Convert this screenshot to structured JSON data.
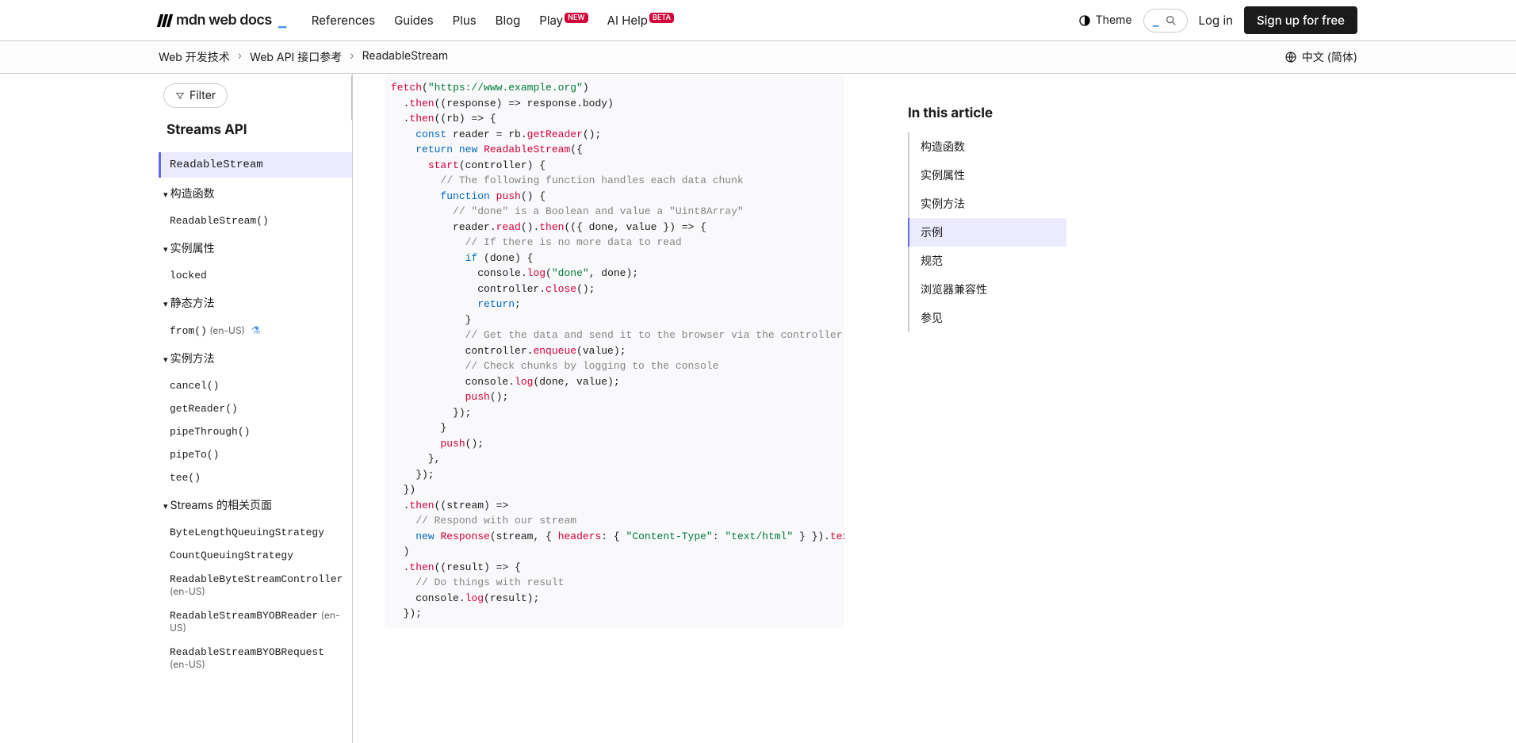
{
  "nav": {
    "logo": "mdn web docs",
    "links": [
      "References",
      "Guides",
      "Plus",
      "Blog",
      "Play",
      "AI Help"
    ],
    "badges": {
      "4": "NEW",
      "5": "BETA"
    },
    "theme": "Theme",
    "login": "Log in",
    "signup": "Sign up for free"
  },
  "breadcrumbs": {
    "items": [
      "Web 开发技术",
      "Web API 接口参考",
      "ReadableStream"
    ],
    "language": "中文 (简体)"
  },
  "sidebar": {
    "filter": "Filter",
    "title": "Streams API",
    "active": "ReadableStream",
    "sections": [
      {
        "header": "构造函数",
        "items": [
          {
            "label": "ReadableStream()"
          }
        ]
      },
      {
        "header": "实例属性",
        "items": [
          {
            "label": "locked"
          }
        ]
      },
      {
        "header": "静态方法",
        "items": [
          {
            "label": "from()",
            "suffix": "(en-US)",
            "flask": true
          }
        ]
      },
      {
        "header": "实例方法",
        "items": [
          {
            "label": "cancel()"
          },
          {
            "label": "getReader()"
          },
          {
            "label": "pipeThrough()"
          },
          {
            "label": "pipeTo()"
          },
          {
            "label": "tee()"
          }
        ]
      },
      {
        "header": "Streams 的相关页面",
        "items": [
          {
            "label": "ByteLengthQueuingStrategy"
          },
          {
            "label": "CountQueuingStrategy"
          },
          {
            "label": "ReadableByteStreamController",
            "suffix": "(en-US)"
          },
          {
            "label": "ReadableStreamBYOBReader",
            "suffix": "(en-US)"
          },
          {
            "label": "ReadableStreamBYOBRequest",
            "suffix": "(en-US)"
          }
        ]
      }
    ]
  },
  "toc": {
    "title": "In this article",
    "items": [
      "构造函数",
      "实例属性",
      "实例方法",
      "示例",
      "规范",
      "浏览器兼容性",
      "参见"
    ],
    "active": 3
  },
  "code": {
    "lines": [
      [
        {
          "t": "fetch",
          "c": "tok-fn"
        },
        {
          "t": "("
        },
        {
          "t": "\"https://www.example.org\"",
          "c": "tok-str"
        },
        {
          "t": ")"
        }
      ],
      [
        {
          "t": "  ."
        },
        {
          "t": "then",
          "c": "tok-prop"
        },
        {
          "t": "(("
        },
        {
          "t": "response",
          "c": "tok-param"
        },
        {
          "t": ") => response.body)"
        }
      ],
      [
        {
          "t": "  ."
        },
        {
          "t": "then",
          "c": "tok-prop"
        },
        {
          "t": "(("
        },
        {
          "t": "rb",
          "c": "tok-param"
        },
        {
          "t": ") => {"
        }
      ],
      [
        {
          "t": "    "
        },
        {
          "t": "const",
          "c": "tok-kw"
        },
        {
          "t": " reader = rb."
        },
        {
          "t": "getReader",
          "c": "tok-prop"
        },
        {
          "t": "();"
        }
      ],
      [
        {
          "t": "    "
        },
        {
          "t": "return",
          "c": "tok-kw"
        },
        {
          "t": " "
        },
        {
          "t": "new",
          "c": "tok-kw"
        },
        {
          "t": " "
        },
        {
          "t": "ReadableStream",
          "c": "tok-fn"
        },
        {
          "t": "({"
        }
      ],
      [
        {
          "t": "      "
        },
        {
          "t": "start",
          "c": "tok-prop"
        },
        {
          "t": "(controller) {"
        }
      ],
      [
        {
          "t": "        "
        },
        {
          "t": "// The following function handles each data chunk",
          "c": "tok-com"
        }
      ],
      [
        {
          "t": "        "
        },
        {
          "t": "function",
          "c": "tok-kw"
        },
        {
          "t": " "
        },
        {
          "t": "push",
          "c": "tok-prop"
        },
        {
          "t": "() {"
        }
      ],
      [
        {
          "t": "          "
        },
        {
          "t": "// \"done\" is a Boolean and value a \"Uint8Array\"",
          "c": "tok-com"
        }
      ],
      [
        {
          "t": "          reader."
        },
        {
          "t": "read",
          "c": "tok-prop"
        },
        {
          "t": "()."
        },
        {
          "t": "then",
          "c": "tok-prop"
        },
        {
          "t": "(({ done, value }) => {"
        }
      ],
      [
        {
          "t": "            "
        },
        {
          "t": "// If there is no more data to read",
          "c": "tok-com"
        }
      ],
      [
        {
          "t": "            "
        },
        {
          "t": "if",
          "c": "tok-kw"
        },
        {
          "t": " (done) {"
        }
      ],
      [
        {
          "t": "              console."
        },
        {
          "t": "log",
          "c": "tok-prop"
        },
        {
          "t": "("
        },
        {
          "t": "\"done\"",
          "c": "tok-str"
        },
        {
          "t": ", done);"
        }
      ],
      [
        {
          "t": "              controller."
        },
        {
          "t": "close",
          "c": "tok-prop"
        },
        {
          "t": "();"
        }
      ],
      [
        {
          "t": "              "
        },
        {
          "t": "return",
          "c": "tok-kw"
        },
        {
          "t": ";"
        }
      ],
      [
        {
          "t": "            }"
        }
      ],
      [
        {
          "t": "            "
        },
        {
          "t": "// Get the data and send it to the browser via the controller",
          "c": "tok-com"
        }
      ],
      [
        {
          "t": "            controller."
        },
        {
          "t": "enqueue",
          "c": "tok-prop"
        },
        {
          "t": "(value);"
        }
      ],
      [
        {
          "t": "            "
        },
        {
          "t": "// Check chunks by logging to the console",
          "c": "tok-com"
        }
      ],
      [
        {
          "t": "            console."
        },
        {
          "t": "log",
          "c": "tok-prop"
        },
        {
          "t": "(done, value);"
        }
      ],
      [
        {
          "t": "            "
        },
        {
          "t": "push",
          "c": "tok-prop"
        },
        {
          "t": "();"
        }
      ],
      [
        {
          "t": "          });"
        }
      ],
      [
        {
          "t": "        }"
        }
      ],
      [
        {
          "t": "        "
        },
        {
          "t": "push",
          "c": "tok-prop"
        },
        {
          "t": "();"
        }
      ],
      [
        {
          "t": "      },"
        }
      ],
      [
        {
          "t": "    });"
        }
      ],
      [
        {
          "t": "  })"
        }
      ],
      [
        {
          "t": "  ."
        },
        {
          "t": "then",
          "c": "tok-prop"
        },
        {
          "t": "(("
        },
        {
          "t": "stream",
          "c": "tok-param"
        },
        {
          "t": ") =>"
        }
      ],
      [
        {
          "t": "    "
        },
        {
          "t": "// Respond with our stream",
          "c": "tok-com"
        }
      ],
      [
        {
          "t": "    "
        },
        {
          "t": "new",
          "c": "tok-kw"
        },
        {
          "t": " "
        },
        {
          "t": "Response",
          "c": "tok-fn"
        },
        {
          "t": "(stream, { "
        },
        {
          "t": "headers",
          "c": "tok-prop"
        },
        {
          "t": ": { "
        },
        {
          "t": "\"Content-Type\"",
          "c": "tok-str"
        },
        {
          "t": ": "
        },
        {
          "t": "\"text/html\"",
          "c": "tok-str"
        },
        {
          "t": " } })."
        },
        {
          "t": "text",
          "c": "tok-prop"
        },
        {
          "t": "(),"
        }
      ],
      [
        {
          "t": "  )"
        }
      ],
      [
        {
          "t": "  ."
        },
        {
          "t": "then",
          "c": "tok-prop"
        },
        {
          "t": "(("
        },
        {
          "t": "result",
          "c": "tok-param"
        },
        {
          "t": ") => {"
        }
      ],
      [
        {
          "t": "    "
        },
        {
          "t": "// Do things with result",
          "c": "tok-com"
        }
      ],
      [
        {
          "t": "    console."
        },
        {
          "t": "log",
          "c": "tok-prop"
        },
        {
          "t": "(result);"
        }
      ],
      [
        {
          "t": "  });"
        }
      ]
    ]
  }
}
